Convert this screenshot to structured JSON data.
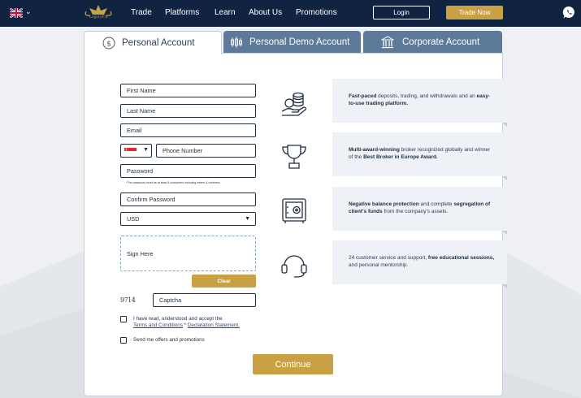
{
  "nav": {
    "links": [
      "Trade",
      "Platforms",
      "Learn",
      "About Us",
      "Promotions"
    ],
    "login_label": "Login",
    "trade_now_label": "Trade Now",
    "logo_text": "LegacyFX"
  },
  "tabs": [
    {
      "label": "Personal Account",
      "icon": "dollar-circle-icon",
      "active": true
    },
    {
      "label": "Personal Demo Account",
      "icon": "candlestick-icon",
      "active": false
    },
    {
      "label": "Corporate Account",
      "icon": "bank-building-icon",
      "active": false
    }
  ],
  "form": {
    "first_name": "First Name",
    "last_name": "Last Name",
    "email": "Email",
    "phone_number": "Phone Number",
    "password": "Password",
    "password_hint": "*The password must be at least 8 characters including letters & numbers.",
    "confirm_password": "Confirm Password",
    "currency": "USD",
    "sign_here": "Sign Here",
    "clear_label": "Clear",
    "captcha_code": "9714",
    "captcha_placeholder": "Captcha",
    "terms_prefix": "I have read, understood and accept the",
    "terms_link": "Terms and Conditions",
    "terms_joiner": " * ",
    "declaration_link": "Declaration Statement.",
    "offers_label": "Send me offers and promotions",
    "continue_label": "Continue"
  },
  "features": [
    {
      "icon": "money-hand-icon",
      "bold1": "Fast-paced",
      "text1": " deposits, trading, and withdrawals and an ",
      "bold2": "easy-to-use trading platform.",
      "text2": ""
    },
    {
      "icon": "trophy-icon",
      "bold1": "Multi-award-winning",
      "text1": " broker recognized globally and winner of the ",
      "bold2": "Best Broker in Europe Award.",
      "text2": ""
    },
    {
      "icon": "safe-icon",
      "bold1": "Negative balance protection",
      "text1": " and complete ",
      "bold2": "segregation of client's funds",
      "text2": " from the company's assets."
    },
    {
      "icon": "headset-icon",
      "bold1": "",
      "text1": "24 customer service and support, ",
      "bold2": "free educational sessions,",
      "text2": " and personal mentorship."
    }
  ],
  "colors": {
    "navy": "#102441",
    "gold": "#c9a043",
    "tab_inactive": "#5d7a9a"
  }
}
